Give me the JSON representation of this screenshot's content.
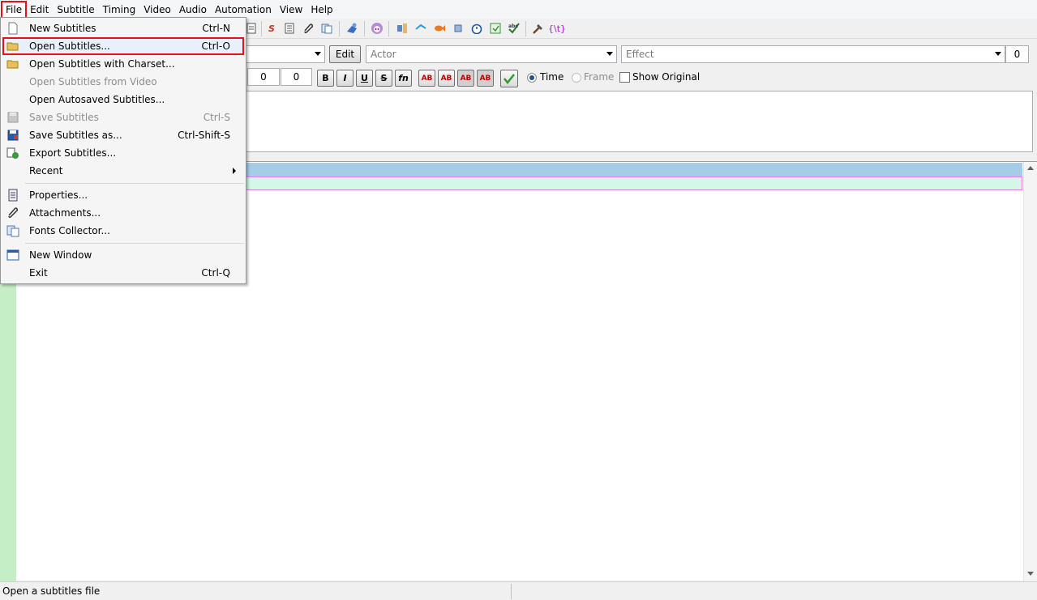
{
  "menubar": {
    "items": [
      "File",
      "Edit",
      "Subtitle",
      "Timing",
      "Video",
      "Audio",
      "Automation",
      "View",
      "Help"
    ]
  },
  "file_menu": {
    "items": [
      {
        "label": "New Subtitles",
        "shortcut": "Ctrl-N",
        "icon": "new-file-icon",
        "disabled": false
      },
      {
        "label": "Open Subtitles...",
        "shortcut": "Ctrl-O",
        "icon": "open-folder-icon",
        "disabled": false,
        "highlighted": true
      },
      {
        "label": "Open Subtitles with Charset...",
        "shortcut": "",
        "icon": "open-folder-icon",
        "disabled": false
      },
      {
        "label": "Open Subtitles from Video",
        "shortcut": "",
        "icon": "",
        "disabled": true
      },
      {
        "label": "Open Autosaved Subtitles...",
        "shortcut": "",
        "icon": "",
        "disabled": false
      },
      {
        "label": "Save Subtitles",
        "shortcut": "Ctrl-S",
        "icon": "save-icon",
        "disabled": true
      },
      {
        "label": "Save Subtitles as...",
        "shortcut": "Ctrl-Shift-S",
        "icon": "save-as-icon",
        "disabled": false
      },
      {
        "label": "Export Subtitles...",
        "shortcut": "",
        "icon": "export-icon",
        "disabled": false
      },
      {
        "label": "Recent",
        "shortcut": "",
        "icon": "",
        "disabled": false,
        "submenu": true
      },
      {
        "label": "Properties...",
        "shortcut": "",
        "icon": "properties-icon",
        "disabled": false
      },
      {
        "label": "Attachments...",
        "shortcut": "",
        "icon": "paperclip-icon",
        "disabled": false
      },
      {
        "label": "Fonts Collector...",
        "shortcut": "",
        "icon": "fonts-icon",
        "disabled": false
      },
      {
        "label": "New Window",
        "shortcut": "",
        "icon": "window-icon",
        "disabled": false
      },
      {
        "label": "Exit",
        "shortcut": "Ctrl-Q",
        "icon": "",
        "disabled": false
      }
    ]
  },
  "editor": {
    "edit_button": "Edit",
    "actor_placeholder": "Actor",
    "effect_placeholder": "Effect",
    "layer_value": "0",
    "margin_values": [
      "0",
      "0"
    ],
    "format_buttons": [
      "B",
      "I",
      "U",
      "S",
      "fn",
      "AB",
      "AB",
      "AB",
      "AB"
    ],
    "time_label": "Time",
    "frame_label": "Frame",
    "show_original_label": "Show Original",
    "time_selected": true
  },
  "status": {
    "text": "Open a subtitles file"
  },
  "colors": {
    "grid_header": "#a6cde8",
    "grid_row": "#d4f7e8",
    "grid_left": "#c6eec6",
    "highlight_outline": "#e2141a"
  }
}
